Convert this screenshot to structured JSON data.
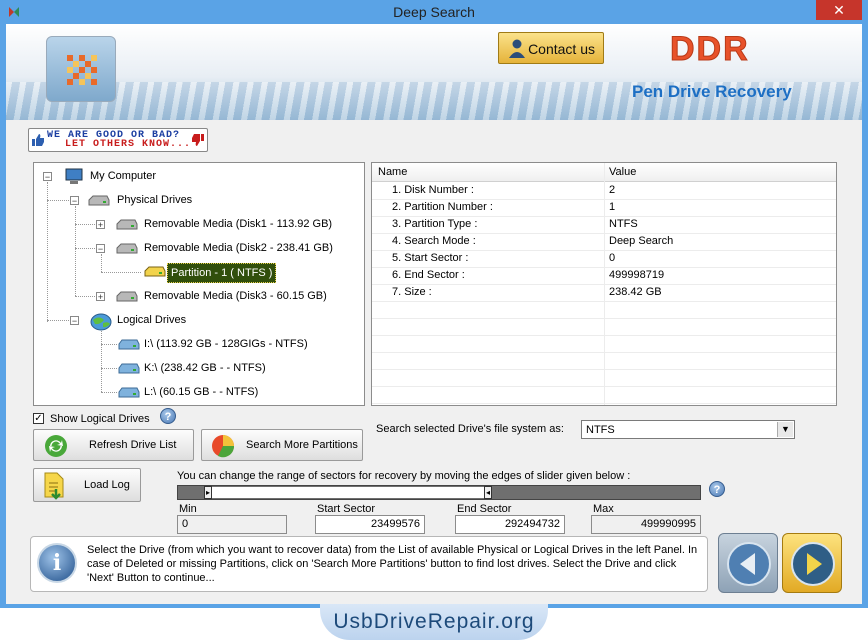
{
  "window": {
    "title": "Deep Search",
    "close_glyph": "✕"
  },
  "header": {
    "contact_label": "Contact us",
    "brand": "DDR",
    "product": "Pen Drive Recovery"
  },
  "feedback": {
    "line1": "WE ARE GOOD OR BAD?",
    "line2": "LET OTHERS KNOW..."
  },
  "tree": {
    "root": "My Computer",
    "physical": "Physical Drives",
    "disk1": "Removable Media (Disk1 - 113.92 GB)",
    "disk2": "Removable Media (Disk2 - 238.41 GB)",
    "partition": "Partition - 1 ( NTFS )",
    "disk3": "Removable Media (Disk3 - 60.15 GB)",
    "logical": "Logical Drives",
    "drive_i": "I:\\ (113.92 GB - 128GIGs - NTFS)",
    "drive_k": "K:\\ (238.42 GB -  - NTFS)",
    "drive_l": "L:\\ (60.15 GB -  - NTFS)",
    "plus": "+",
    "minus": "−"
  },
  "properties": {
    "col_name": "Name",
    "col_value": "Value",
    "rows": [
      {
        "name": "1. Disk Number :",
        "value": "2"
      },
      {
        "name": "2. Partition Number :",
        "value": "1"
      },
      {
        "name": "3. Partition Type :",
        "value": "NTFS"
      },
      {
        "name": "4. Search Mode :",
        "value": "Deep Search"
      },
      {
        "name": "5. Start Sector :",
        "value": "0"
      },
      {
        "name": "6. End Sector :",
        "value": "499998719"
      },
      {
        "name": "7. Size :",
        "value": "238.42 GB"
      }
    ]
  },
  "controls": {
    "show_logical": "Show Logical Drives",
    "check_mark": "✓",
    "help_glyph": "?",
    "refresh": "Refresh Drive List",
    "search_more": "Search More Partitions",
    "fs_label": "Search selected Drive's file system as:",
    "fs_value": "NTFS",
    "dropdown_arrow": "▼",
    "load_log": "Load Log"
  },
  "sectors": {
    "hint": "You can change the range of sectors for recovery by moving the edges of slider given below :",
    "min_label": "Min",
    "min_value": "0",
    "start_label": "Start Sector",
    "start_value": "23499576",
    "end_label": "End Sector",
    "end_value": "292494732",
    "max_label": "Max",
    "max_value": "499990995",
    "thumb_left": "▸",
    "thumb_right": "◂"
  },
  "info": {
    "glyph": "i",
    "text": "Select the Drive (from which you want to recover data) from the List of available Physical or Logical Drives in the left Panel. In case of Deleted or missing Partitions, click on 'Search More Partitions' button to find lost drives. Select the Drive and click 'Next' Button to continue..."
  },
  "footer": {
    "site": "UsbDriveRepair.org"
  },
  "colors": {
    "accent": "#5aa3e6",
    "brand": "#e8522a",
    "product": "#1d6fc4",
    "selection": "#314f0c"
  }
}
